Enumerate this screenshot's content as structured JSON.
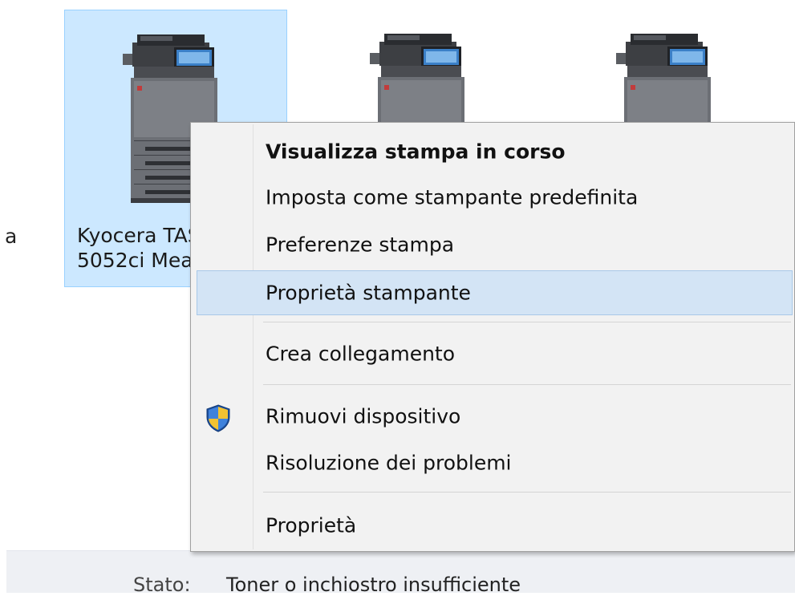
{
  "background_fragment": "a",
  "device": {
    "name_line1": "Kyocera TASKalfa",
    "name_line2": "5052ci Measurement"
  },
  "status": {
    "label": "Stato:",
    "value": "Toner o inchiostro insufficiente"
  },
  "context_menu": {
    "items": [
      {
        "label": "Visualizza stampa in corso",
        "bold": true
      },
      {
        "label": "Imposta come stampante predefinita"
      },
      {
        "label": "Preferenze stampa"
      },
      {
        "label": "Proprietà stampante",
        "highlighted": true
      },
      {
        "label": "Crea collegamento"
      },
      {
        "label": "Rimuovi dispositivo",
        "icon": "uac-shield-icon"
      },
      {
        "label": "Risoluzione dei problemi"
      },
      {
        "label": "Proprietà"
      }
    ]
  },
  "colors": {
    "selection_fill": "#cce8ff",
    "selection_border": "#99d1ff",
    "menu_background": "#f2f2f2",
    "menu_hover": "#d3e4f5",
    "status_bar": "#eef0f4"
  }
}
